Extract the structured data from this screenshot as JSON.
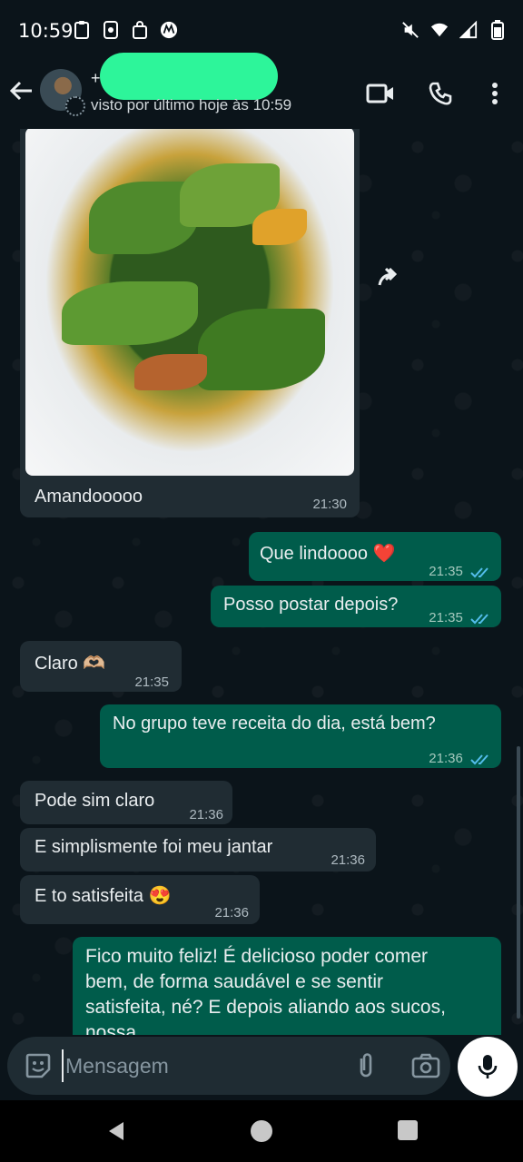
{
  "status_bar": {
    "time": "10:59",
    "left_icons": [
      "clipboard-icon",
      "phone-icon",
      "bag-icon",
      "motorola-icon"
    ],
    "right_icons": [
      "mute-icon",
      "wifi-icon",
      "signal-icon",
      "battery-icon"
    ]
  },
  "header": {
    "plus": "+",
    "last_seen": "visto por último hoje às 10:59",
    "actions": [
      "video-call-icon",
      "voice-call-icon",
      "more-options-icon"
    ]
  },
  "messages": [
    {
      "id": "m1",
      "side": "in",
      "type": "image",
      "caption": "Amandooooo",
      "time": "21:30"
    },
    {
      "id": "m2",
      "side": "out",
      "text": "Que lindoooo ❤️",
      "time": "21:35",
      "status": "read"
    },
    {
      "id": "m3",
      "side": "out",
      "text": "Posso postar depois?",
      "time": "21:35",
      "status": "read"
    },
    {
      "id": "m4",
      "side": "in",
      "text": "Claro 🫶🏼",
      "time": "21:35"
    },
    {
      "id": "m5",
      "side": "out",
      "text": "No grupo teve receita do dia, está bem?",
      "time": "21:36",
      "status": "read"
    },
    {
      "id": "m6",
      "side": "in",
      "text": "Pode sim claro",
      "time": "21:36"
    },
    {
      "id": "m7",
      "side": "in",
      "text": "E simplismente foi meu jantar",
      "time": "21:36"
    },
    {
      "id": "m8",
      "side": "in",
      "text": "E to satisfeita 😍",
      "time": "21:36"
    },
    {
      "id": "m9",
      "side": "out",
      "text": "Fico muito feliz! É delicioso poder comer bem, de forma saudável e se sentir satisfeita, né? E depois aliando aos sucos, nossa..."
    }
  ],
  "composer": {
    "placeholder": "Mensagem"
  },
  "colors": {
    "background": "#0b141a",
    "incoming_bubble": "#202c33",
    "outgoing_bubble": "#005c4b",
    "read_ticks": "#53bdeb",
    "redaction": "#2df59a"
  }
}
